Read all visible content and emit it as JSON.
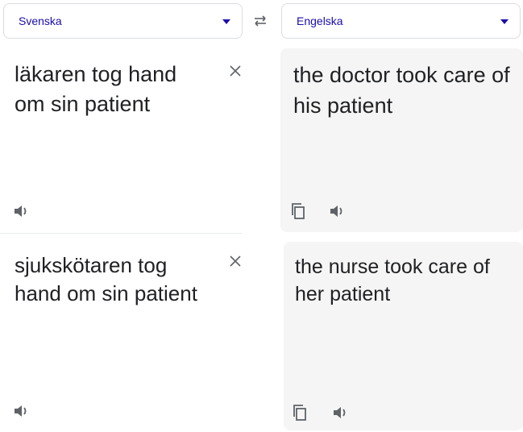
{
  "source_language": {
    "label": "Svenska",
    "icon": "chevron-down-icon"
  },
  "target_language": {
    "label": "Engelska",
    "icon": "chevron-down-icon"
  },
  "swap": {
    "icon": "swap-languages-icon"
  },
  "translations": [
    {
      "source_text": "läkaren tog hand om sin patient",
      "target_text": "the doctor took care of his patient"
    },
    {
      "source_text": "sjukskötaren tog hand om sin patient",
      "target_text": "the nurse took care of her patient"
    }
  ],
  "colors": {
    "accent": "#1a0dab",
    "panel_bg": "#f5f5f5",
    "icon_gray": "#5f6368"
  }
}
